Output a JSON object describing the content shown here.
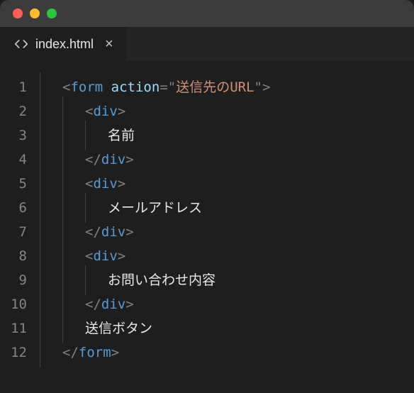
{
  "tab": {
    "filename": "index.html"
  },
  "gutter": [
    "1",
    "2",
    "3",
    "4",
    "5",
    "6",
    "7",
    "8",
    "9",
    "10",
    "11",
    "12"
  ],
  "code": {
    "l1": {
      "indent": 1,
      "tokens": [
        [
          "p",
          "<"
        ],
        [
          "tg",
          "form"
        ],
        [
          "tx",
          " "
        ],
        [
          "at",
          "action"
        ],
        [
          "p",
          "="
        ],
        [
          "p",
          "\""
        ],
        [
          "st",
          "送信先のURL"
        ],
        [
          "p",
          "\""
        ],
        [
          "p",
          ">"
        ]
      ]
    },
    "l2": {
      "indent": 2,
      "tokens": [
        [
          "p",
          "<"
        ],
        [
          "tg",
          "div"
        ],
        [
          "p",
          ">"
        ]
      ]
    },
    "l3": {
      "indent": 3,
      "tokens": [
        [
          "tx",
          "名前"
        ]
      ]
    },
    "l4": {
      "indent": 2,
      "tokens": [
        [
          "p",
          "</"
        ],
        [
          "tg",
          "div"
        ],
        [
          "p",
          ">"
        ]
      ]
    },
    "l5": {
      "indent": 2,
      "tokens": [
        [
          "p",
          "<"
        ],
        [
          "tg",
          "div"
        ],
        [
          "p",
          ">"
        ]
      ]
    },
    "l6": {
      "indent": 3,
      "tokens": [
        [
          "tx",
          "メールアドレス"
        ]
      ]
    },
    "l7": {
      "indent": 2,
      "tokens": [
        [
          "p",
          "</"
        ],
        [
          "tg",
          "div"
        ],
        [
          "p",
          ">"
        ]
      ]
    },
    "l8": {
      "indent": 2,
      "tokens": [
        [
          "p",
          "<"
        ],
        [
          "tg",
          "div"
        ],
        [
          "p",
          ">"
        ]
      ]
    },
    "l9": {
      "indent": 3,
      "tokens": [
        [
          "tx",
          "お問い合わせ内容"
        ]
      ]
    },
    "l10": {
      "indent": 2,
      "tokens": [
        [
          "p",
          "</"
        ],
        [
          "tg",
          "div"
        ],
        [
          "p",
          ">"
        ]
      ]
    },
    "l11": {
      "indent": 2,
      "tokens": [
        [
          "tx",
          "送信ボタン"
        ]
      ]
    },
    "l12": {
      "indent": 1,
      "tokens": [
        [
          "p",
          "</"
        ],
        [
          "tg",
          "form"
        ],
        [
          "p",
          ">"
        ]
      ]
    }
  }
}
